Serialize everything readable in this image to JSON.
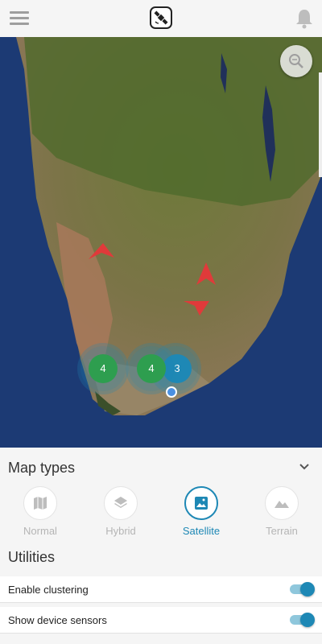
{
  "app": {
    "menu_icon": "hamburger-icon",
    "logo_icon": "satellite-logo-icon",
    "notification_icon": "bell-icon"
  },
  "map": {
    "type": "satellite",
    "zoom_icon": "magnifier-icon",
    "clusters": [
      {
        "count": "4",
        "color": "#2e9e4f"
      },
      {
        "count": "4",
        "color": "#2e9e4f"
      },
      {
        "count": "3",
        "color": "#1e88b5"
      }
    ],
    "markers": [
      "arrow-marker-1",
      "arrow-marker-2",
      "arrow-marker-3"
    ],
    "device_location_color": "#4a90e2",
    "marker_color": "#e03a3a"
  },
  "panel": {
    "map_types_title": "Map types",
    "collapse_icon": "chevron-down-icon",
    "map_types": [
      {
        "label": "Normal",
        "icon": "map-icon",
        "selected": false
      },
      {
        "label": "Hybrid",
        "icon": "layers-icon",
        "selected": false
      },
      {
        "label": "Satellite",
        "icon": "image-icon",
        "selected": true
      },
      {
        "label": "Terrain",
        "icon": "mountain-icon",
        "selected": false
      }
    ],
    "utilities_title": "Utilities",
    "settings": [
      {
        "label": "Enable clustering",
        "enabled": true
      },
      {
        "label": "Show device sensors",
        "enabled": true
      }
    ],
    "accent_color": "#1e88b5"
  }
}
